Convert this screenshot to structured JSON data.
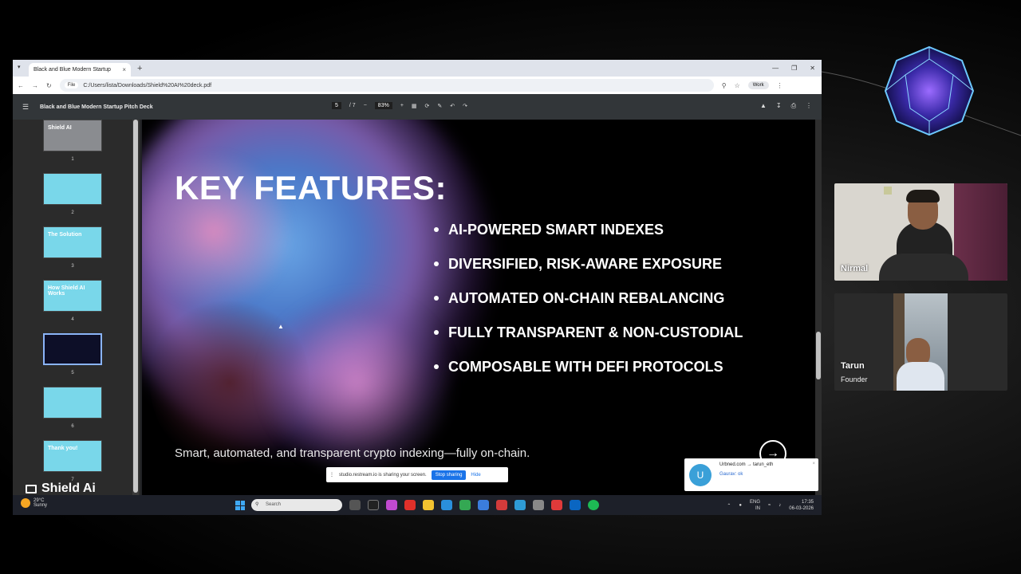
{
  "browser": {
    "tab_title": "Black and Blue Modern Startup",
    "new_tab": "+",
    "file_chip": "File",
    "url": "C:/Users/lista/Downloads/Shield%20AI%20deck.pdf",
    "profile": "Work"
  },
  "pdf_toolbar": {
    "title": "Black and Blue Modern Startup Pitch Deck",
    "page_current": "5",
    "page_total": "/ 7",
    "zoom": "83%"
  },
  "thumbnails": [
    {
      "num": "1",
      "label": "Shield AI"
    },
    {
      "num": "2"
    },
    {
      "num": "3",
      "label": "The Solution"
    },
    {
      "num": "4",
      "label": "How Shield AI Works"
    },
    {
      "num": "5",
      "selected": true
    },
    {
      "num": "6"
    },
    {
      "num": "7",
      "label": "Thank you!"
    }
  ],
  "brand": {
    "name": "Shield Ai"
  },
  "slide": {
    "title": "KEY FEATURES:",
    "features": [
      "AI-POWERED SMART INDEXES",
      "DIVERSIFIED, RISK-AWARE EXPOSURE",
      "AUTOMATED ON-CHAIN REBALANCING",
      "FULLY TRANSPARENT & NON-CUSTODIAL",
      "COMPOSABLE WITH DEFI PROTOCOLS"
    ],
    "subtitle": "Smart, automated, and transparent crypto indexing—fully on-chain."
  },
  "share_banner": {
    "text": "studio.restream.io is sharing your screen.",
    "stop_label": "Stop sharing",
    "hide_label": "Hide"
  },
  "notification": {
    "avatar_letter": "U",
    "from": "Urbned.com → tarun_eth",
    "message": "Gaurav: ok"
  },
  "taskbar": {
    "temp": "29°C",
    "weather": "Sunny",
    "search_placeholder": "Search",
    "lang_top": "ENG",
    "lang_bottom": "IN",
    "time": "17:35",
    "date": "06-03-2026"
  },
  "participants": [
    {
      "name": "Nirmal",
      "title": ""
    },
    {
      "name": "Tarun",
      "title": "Founder"
    }
  ],
  "colors": {
    "accent_blue": "#1a73e8",
    "thumb_highlight": "#8ab4f8",
    "pdf_toolbar_bg": "#323639"
  }
}
